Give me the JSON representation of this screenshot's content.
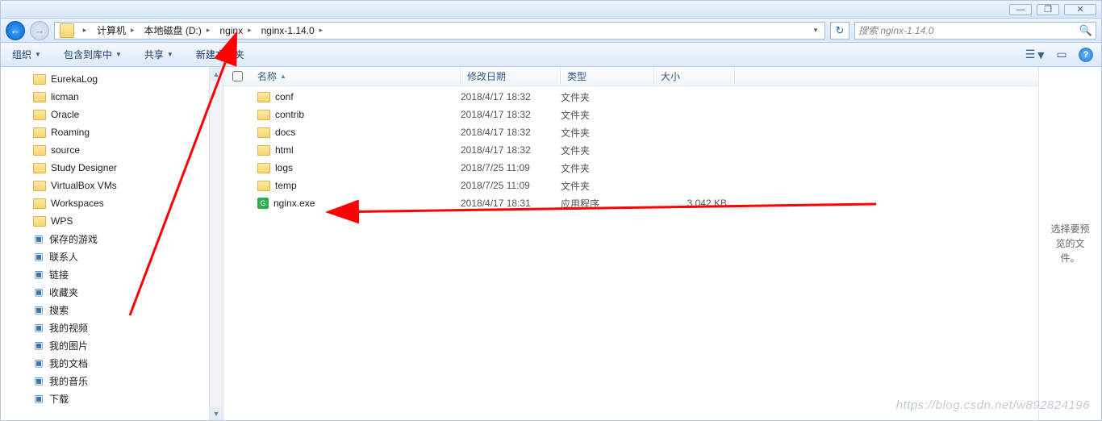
{
  "title_hint": "",
  "window_buttons": {
    "min": "—",
    "max": "❐",
    "close": "✕"
  },
  "nav": {
    "back": "←",
    "fwd": "→"
  },
  "breadcrumbs": [
    "计算机",
    "本地磁盘 (D:)",
    "nginx",
    "nginx-1.14.0"
  ],
  "address_dropdown": "▾",
  "refresh": "↻",
  "search_placeholder": "搜索 nginx-1.14.0",
  "search_icon": "🔍",
  "toolbar": {
    "organize": "组织",
    "include": "包含到库中",
    "share": "共享",
    "newfolder": "新建文件夹",
    "viewmode": "☰",
    "preview_toggle": "▭",
    "help": "?"
  },
  "tree": [
    {
      "label": "EurekaLog",
      "icon": "folder"
    },
    {
      "label": "licman",
      "icon": "folder"
    },
    {
      "label": "Oracle",
      "icon": "folder"
    },
    {
      "label": "Roaming",
      "icon": "folder"
    },
    {
      "label": "source",
      "icon": "folder"
    },
    {
      "label": "Study Designer",
      "icon": "folder"
    },
    {
      "label": "VirtualBox VMs",
      "icon": "folder"
    },
    {
      "label": "Workspaces",
      "icon": "folder"
    },
    {
      "label": "WPS",
      "icon": "folder"
    },
    {
      "label": "保存的游戏",
      "icon": "sp"
    },
    {
      "label": "联系人",
      "icon": "sp"
    },
    {
      "label": "链接",
      "icon": "sp"
    },
    {
      "label": "收藏夹",
      "icon": "sp"
    },
    {
      "label": "搜索",
      "icon": "sp"
    },
    {
      "label": "我的视频",
      "icon": "sp"
    },
    {
      "label": "我的图片",
      "icon": "sp"
    },
    {
      "label": "我的文档",
      "icon": "sp"
    },
    {
      "label": "我的音乐",
      "icon": "sp"
    },
    {
      "label": "下载",
      "icon": "sp"
    }
  ],
  "columns": {
    "name": "名称",
    "date": "修改日期",
    "type": "类型",
    "size": "大小"
  },
  "files": [
    {
      "name": "conf",
      "date": "2018/4/17 18:32",
      "type": "文件夹",
      "size": "",
      "kind": "folder"
    },
    {
      "name": "contrib",
      "date": "2018/4/17 18:32",
      "type": "文件夹",
      "size": "",
      "kind": "folder"
    },
    {
      "name": "docs",
      "date": "2018/4/17 18:32",
      "type": "文件夹",
      "size": "",
      "kind": "folder"
    },
    {
      "name": "html",
      "date": "2018/4/17 18:32",
      "type": "文件夹",
      "size": "",
      "kind": "folder"
    },
    {
      "name": "logs",
      "date": "2018/7/25 11:09",
      "type": "文件夹",
      "size": "",
      "kind": "folder"
    },
    {
      "name": "temp",
      "date": "2018/7/25 11:09",
      "type": "文件夹",
      "size": "",
      "kind": "folder"
    },
    {
      "name": "nginx.exe",
      "date": "2018/4/17 18:31",
      "type": "应用程序",
      "size": "3,042 KB",
      "kind": "exe"
    }
  ],
  "preview_hint": "选择要预览的文件。",
  "watermark": "https://blog.csdn.net/w892824196"
}
